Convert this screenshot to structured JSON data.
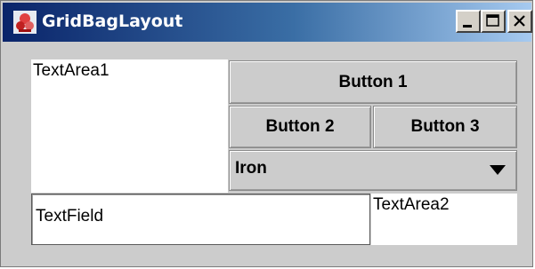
{
  "window": {
    "title": "GridBagLayout",
    "controls": [
      "minimize-icon",
      "maximize-icon",
      "close-icon"
    ]
  },
  "content": {
    "textarea1": "TextArea1",
    "button1": "Button 1",
    "button2": "Button 2",
    "button3": "Button 3",
    "combo": {
      "selected": "Iron"
    },
    "textfield": "TextField",
    "textarea2": "TextArea2"
  },
  "colors": {
    "titlebar_start": "#0a246a",
    "titlebar_end": "#a6caf0",
    "panel": "#cccccc"
  }
}
